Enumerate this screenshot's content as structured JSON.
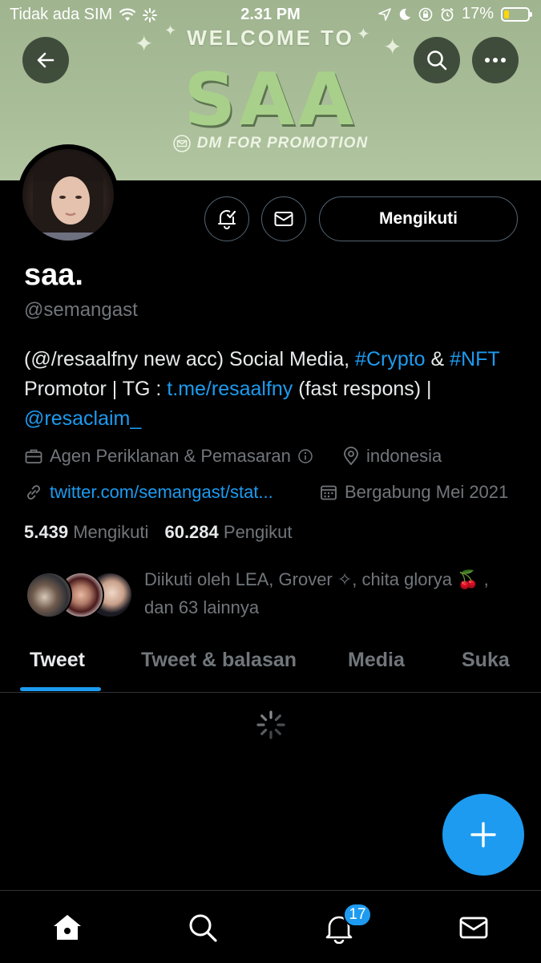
{
  "status_bar": {
    "carrier": "Tidak ada SIM",
    "time": "2.31 PM",
    "battery": "17%",
    "battery_level": 0.17
  },
  "banner": {
    "welcome": "WELCOME TO",
    "title": "SAA",
    "promo": "DM FOR PROMOTION"
  },
  "profile": {
    "follow_button": "Mengikuti",
    "name": "saa.",
    "handle": "@semangast",
    "bio": {
      "p1": "(@/resaalfny new acc) Social Media, ",
      "crypto": "#Crypto",
      "p2": " & ",
      "nft": "#NFT",
      "p3": " Promotor | TG : ",
      "tg_link": "t.me/resaalfny",
      "p4": " (fast respons) | ",
      "mention": "@resaclaim_"
    },
    "category": "Agen Periklanan & Pemasaran",
    "location": "indonesia",
    "website": "twitter.com/semangast/stat...",
    "joined": "Bergabung Mei 2021",
    "following_count": "5.439",
    "following_label": "Mengikuti",
    "followers_count": "60.284",
    "followers_label": "Pengikut",
    "followed_by": "Diikuti oleh LEA, Grover ✧, chita glorya 🍒 , dan 63 lainnya"
  },
  "tabs": [
    "Tweet",
    "Tweet & balasan",
    "Media",
    "Suka"
  ],
  "bottom_nav": {
    "notifications_badge": "17"
  },
  "colors": {
    "accent": "#1d9bf0",
    "background": "#000000",
    "secondary_text": "#71767b",
    "banner": "#a8bd98"
  }
}
